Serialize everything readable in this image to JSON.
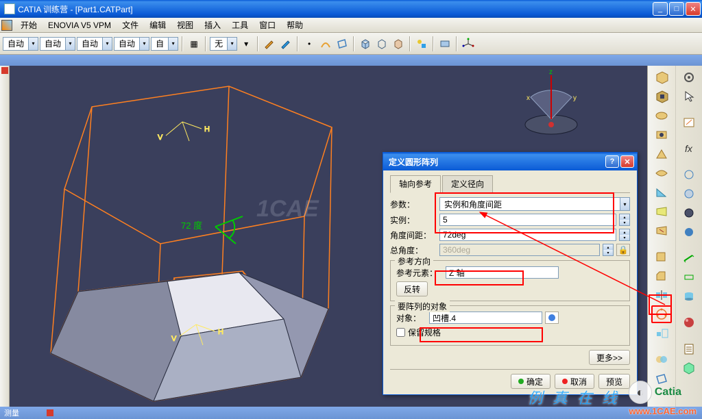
{
  "window": {
    "title": "CATIA 训练营 - [Part1.CATPart]"
  },
  "menu": {
    "start": "开始",
    "enovia": "ENOVIA V5 VPM",
    "file": "文件",
    "edit": "编辑",
    "view": "视图",
    "insert": "插入",
    "tools": "工具",
    "window": "窗口",
    "help": "帮助"
  },
  "toolbar": {
    "auto1": "自动",
    "auto2": "自动",
    "auto3": "自动",
    "auto4": "自动",
    "auto5": "自",
    "none": "无"
  },
  "dialog": {
    "title": "定义圆形阵列",
    "tab1": "轴向参考",
    "tab2": "定义径向",
    "param_label": "参数：",
    "param_value": "实例和角度间距",
    "instance_label": "实例：",
    "instance_value": "5",
    "angle_label": "角度间距：",
    "angle_value": "72deg",
    "total_angle_label": "总角度：",
    "total_angle_value": "360deg",
    "refdir_legend": "参考方向",
    "refelem_label": "参考元素：",
    "refelem_value": "Z 轴",
    "reverse": "反转",
    "objects_legend": "要阵列的对象",
    "object_label": "对象：",
    "object_value": "凹槽.4",
    "keep_spec": "保留规格",
    "more": "更多>>",
    "ok": "确定",
    "cancel": "取消",
    "preview": "预览"
  },
  "status": {
    "measure": "测量"
  },
  "viewport": {
    "angle_label": "72 度",
    "axis_v": "V",
    "axis_h": "H",
    "axis_z": "z"
  },
  "watermark": {
    "cae_text": "1CAE",
    "url": "www.1CAE.com",
    "catia": "Catia",
    "wm3": "例 真 在 线"
  }
}
